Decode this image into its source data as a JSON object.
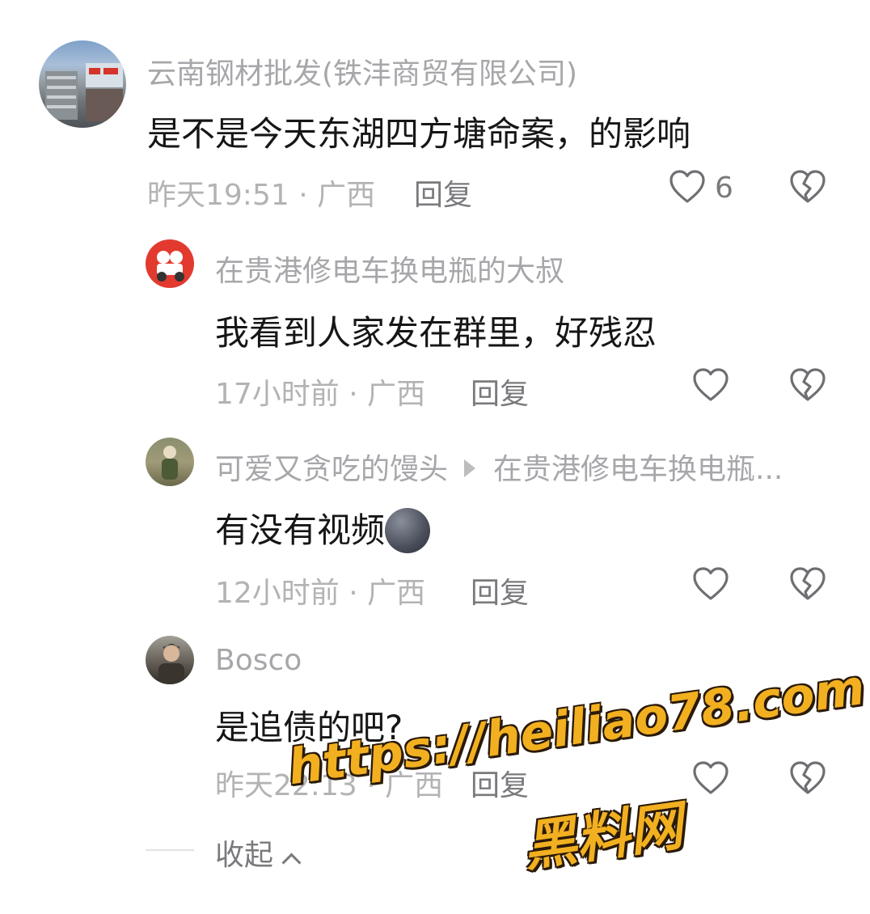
{
  "comments": [
    {
      "username": "云南钢材批发(铁沣商贸有限公司)",
      "text": "是不是今天东湖四方塘命案，的影响",
      "time_loc": "昨天19:51 · 广西",
      "reply_label": "回复",
      "like_count": "6"
    },
    {
      "username": "在贵港修电车换电瓶的大叔",
      "text": "我看到人家发在群里，好残忍",
      "time_loc": "17小时前 · 广西",
      "reply_label": "回复"
    },
    {
      "username": "可爱又贪吃的馒头",
      "reply_to": "在贵港修电车换电瓶...",
      "text": "有没有视频",
      "time_loc": "12小时前 · 广西",
      "reply_label": "回复"
    },
    {
      "username": "Bosco",
      "text": "是追债的吧?",
      "time_loc": "昨天22:13 · 广西",
      "reply_label": "回复"
    }
  ],
  "collapse_label": "收起",
  "watermark": {
    "url": "https://heiliao78.com",
    "name": "黑料网"
  },
  "icons": {
    "like": "heart-outline-icon",
    "dislike": "broken-heart-icon",
    "emoji": "new-moon-face-emoji"
  },
  "colors": {
    "username": "#a7a7ab",
    "text": "#161616",
    "meta": "#b3b3b6",
    "watermark": "#f2b020"
  }
}
